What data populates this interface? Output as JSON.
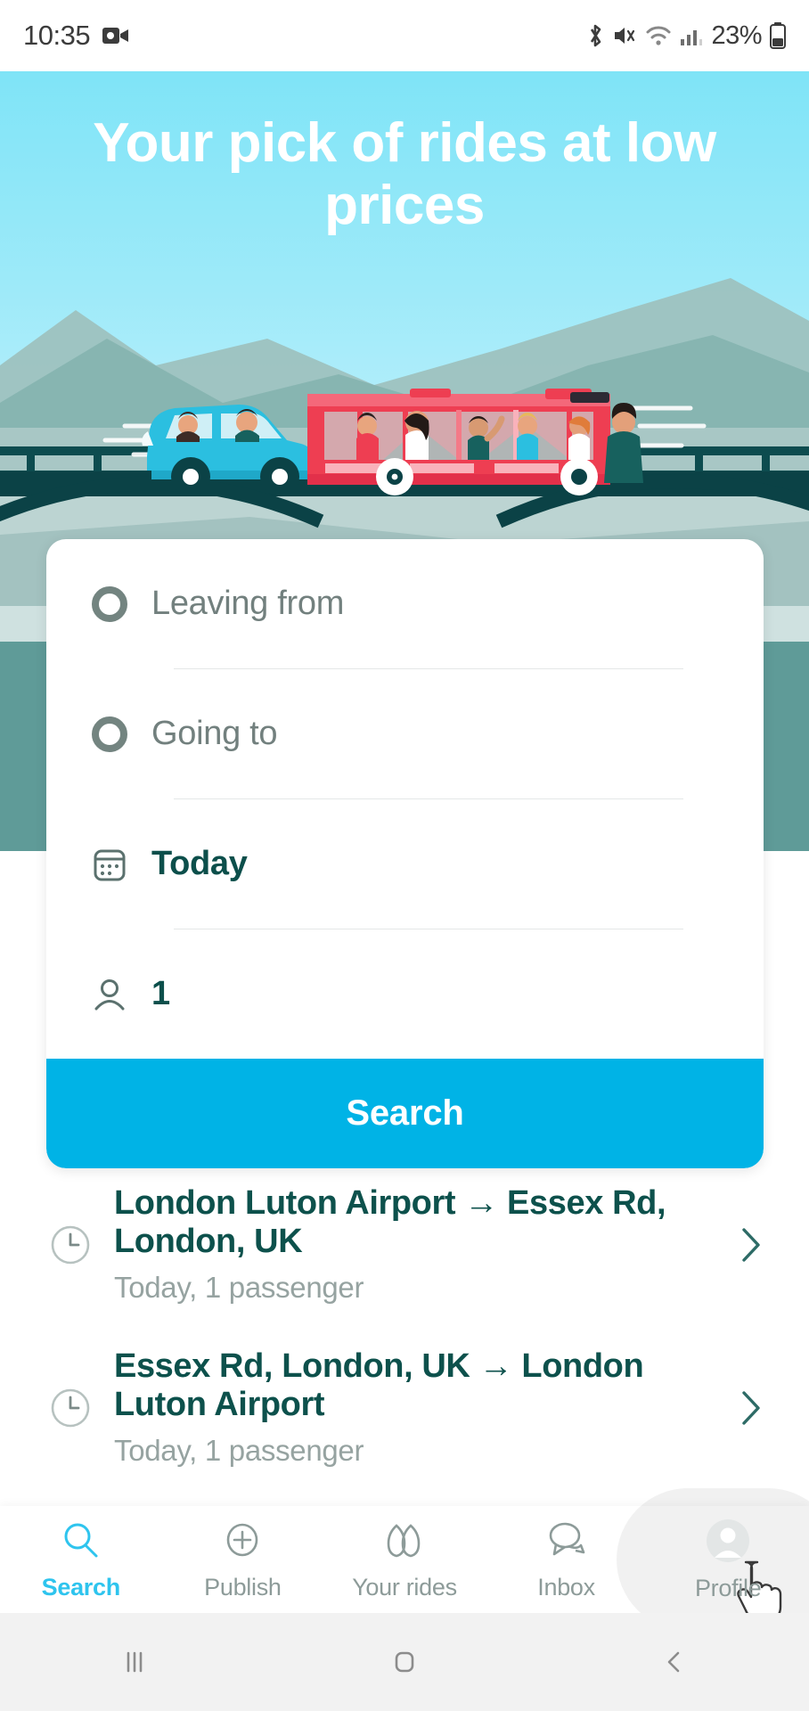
{
  "statusbar": {
    "time": "10:35",
    "battery_pct": "23%",
    "icons": [
      "video-record-icon",
      "bluetooth-icon",
      "mute-icon",
      "wifi-icon",
      "signal-icon",
      "battery-icon"
    ]
  },
  "hero": {
    "headline": "Your pick of rides at low prices",
    "illustration": "car-and-bus-on-bridge-illustration",
    "colors": {
      "sky_top": "#7fe4f7",
      "sky_bottom": "#cdf3fb",
      "bus_red": "#ee3e52",
      "car_blue": "#2bbfe0",
      "bridge_teal": "#0d4c4f"
    }
  },
  "search_card": {
    "leaving_from": {
      "icon": "circle-outline-icon",
      "placeholder": "Leaving from",
      "value": ""
    },
    "going_to": {
      "icon": "circle-outline-icon",
      "placeholder": "Going to",
      "value": ""
    },
    "date": {
      "icon": "calendar-icon",
      "value": "Today"
    },
    "passengers": {
      "icon": "person-icon",
      "value": "1"
    },
    "search_button": {
      "label": "Search",
      "color": "#00b3e6"
    }
  },
  "recent_searches": [
    {
      "icon": "clock-icon",
      "title": "London Luton Airport → Essex Rd, London, UK",
      "subtitle": "Today, 1 passenger",
      "chevron": "chevron-right-icon"
    },
    {
      "icon": "clock-icon",
      "title": "Essex Rd, London, UK → London Luton Airport",
      "subtitle": "Today, 1 passenger",
      "chevron": "chevron-right-icon"
    }
  ],
  "bottom_nav": {
    "active": "Search",
    "active_color": "#2ec4ee",
    "items": [
      {
        "label": "Search",
        "icon": "search-icon"
      },
      {
        "label": "Publish",
        "icon": "plus-circle-icon"
      },
      {
        "label": "Your rides",
        "icon": "rides-icon"
      },
      {
        "label": "Inbox",
        "icon": "chat-bubbles-icon"
      },
      {
        "label": "Profile",
        "icon": "avatar-icon"
      }
    ]
  },
  "android_nav": {
    "items": [
      {
        "label": "Recents",
        "icon": "recents-icon"
      },
      {
        "label": "Home",
        "icon": "home-icon"
      },
      {
        "label": "Back",
        "icon": "back-icon"
      }
    ]
  }
}
